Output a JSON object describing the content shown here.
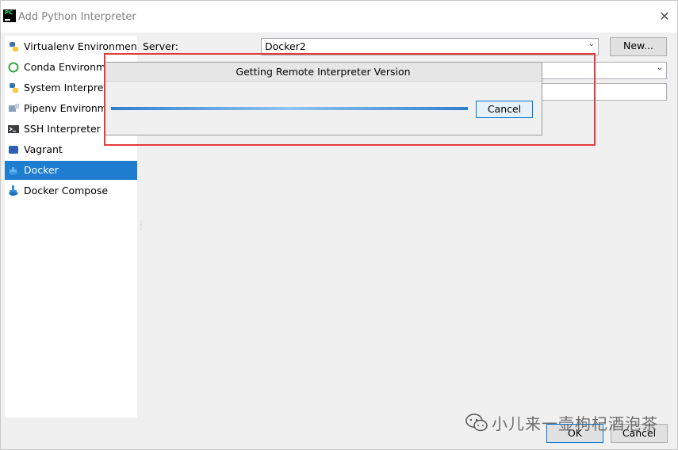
{
  "window": {
    "title": "Add Python Interpreter"
  },
  "sidebar": {
    "items": [
      {
        "label": "Virtualenv Environment",
        "icon": "python-icon",
        "selected": false
      },
      {
        "label": "Conda Environment",
        "icon": "conda-icon",
        "selected": false
      },
      {
        "label": "System Interpreter",
        "icon": "python-icon",
        "selected": false
      },
      {
        "label": "Pipenv Environment",
        "icon": "pipenv-icon",
        "selected": false
      },
      {
        "label": "SSH Interpreter",
        "icon": "terminal-icon",
        "selected": false
      },
      {
        "label": "Vagrant",
        "icon": "vagrant-icon",
        "selected": false
      },
      {
        "label": "Docker",
        "icon": "docker-icon",
        "selected": true
      },
      {
        "label": "Docker Compose",
        "icon": "docker-compose-icon",
        "selected": false
      }
    ]
  },
  "form": {
    "server_label": "Server:",
    "server_value": "Docker2",
    "new_button": "New..."
  },
  "progress_dialog": {
    "title": "Getting Remote Interpreter Version",
    "cancel_label": "Cancel"
  },
  "footer": {
    "ok_label": "OK",
    "cancel_label": "Cancel"
  },
  "watermark": {
    "text": "小儿来一壶枸杞酒泡茶"
  },
  "colors": {
    "selection": "#1f7dcf",
    "highlight_border": "#e23b3b",
    "progress": "#2f7fcf"
  }
}
